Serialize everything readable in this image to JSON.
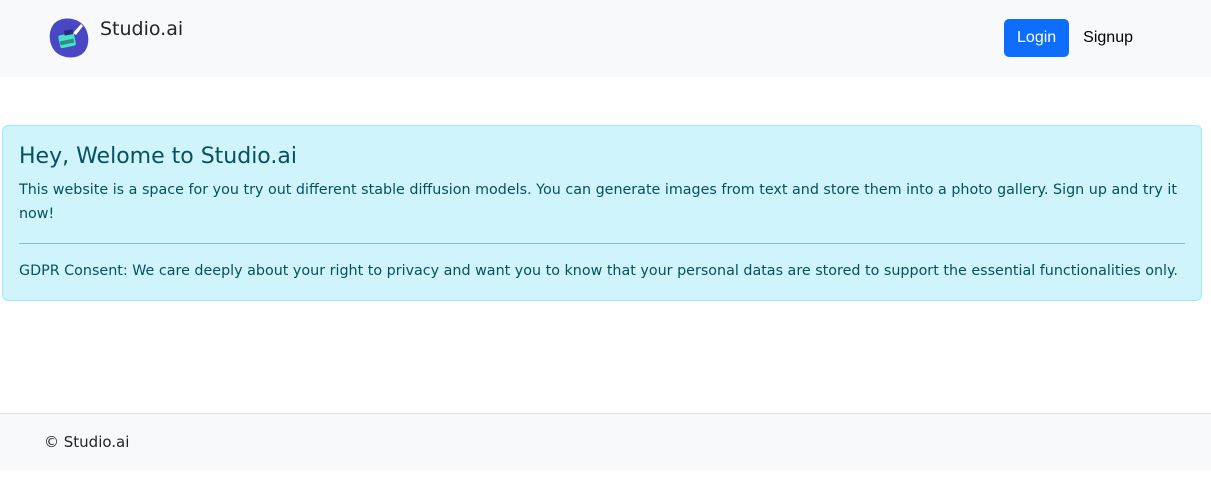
{
  "navbar": {
    "brand_name": "Studio.ai",
    "logo_icon": "paintbrush-blob-icon",
    "login_label": "Login",
    "signup_label": "Signup"
  },
  "alert": {
    "heading": "Hey, Welome to Studio.ai",
    "body": "This website is a space for you try out different stable diffusion models. You can generate images from text and store them into a photo gallery. Sign up and try it now!",
    "gdpr": "GDPR Consent: We care deeply about your right to privacy and want you to know that your personal datas are stored to support the essential functionalities only."
  },
  "footer": {
    "copyright": "© Studio.ai"
  },
  "colors": {
    "navbar_bg": "#f8f9fa",
    "primary": "#0d6efd",
    "alert_bg": "#cff4fc",
    "alert_border": "#9eeaf9",
    "alert_text": "#055160",
    "logo_blob": "#4a47c4",
    "logo_brush": "#49e0c8"
  }
}
